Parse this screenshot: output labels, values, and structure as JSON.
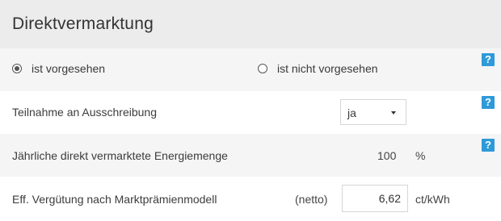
{
  "header": {
    "title": "Direktvermarktung"
  },
  "radio": {
    "option_yes": "ist vorgesehen",
    "option_no": "ist nicht vorgesehen",
    "selected": "ist vorgesehen"
  },
  "tender": {
    "label": "Teilnahme an Ausschreibung",
    "selected": "ja"
  },
  "energy": {
    "label": "Jährliche direkt vermarktete Energiemenge",
    "value": "100",
    "unit": "%"
  },
  "remuneration": {
    "label": "Eff. Vergütung nach Marktprämienmodell",
    "qualifier": "(netto)",
    "value": "6,62",
    "unit": "ct/kWh"
  },
  "help": {
    "label": "?"
  },
  "colors": {
    "help_blue": "#2e9ad8",
    "header_bg": "#ececec"
  }
}
